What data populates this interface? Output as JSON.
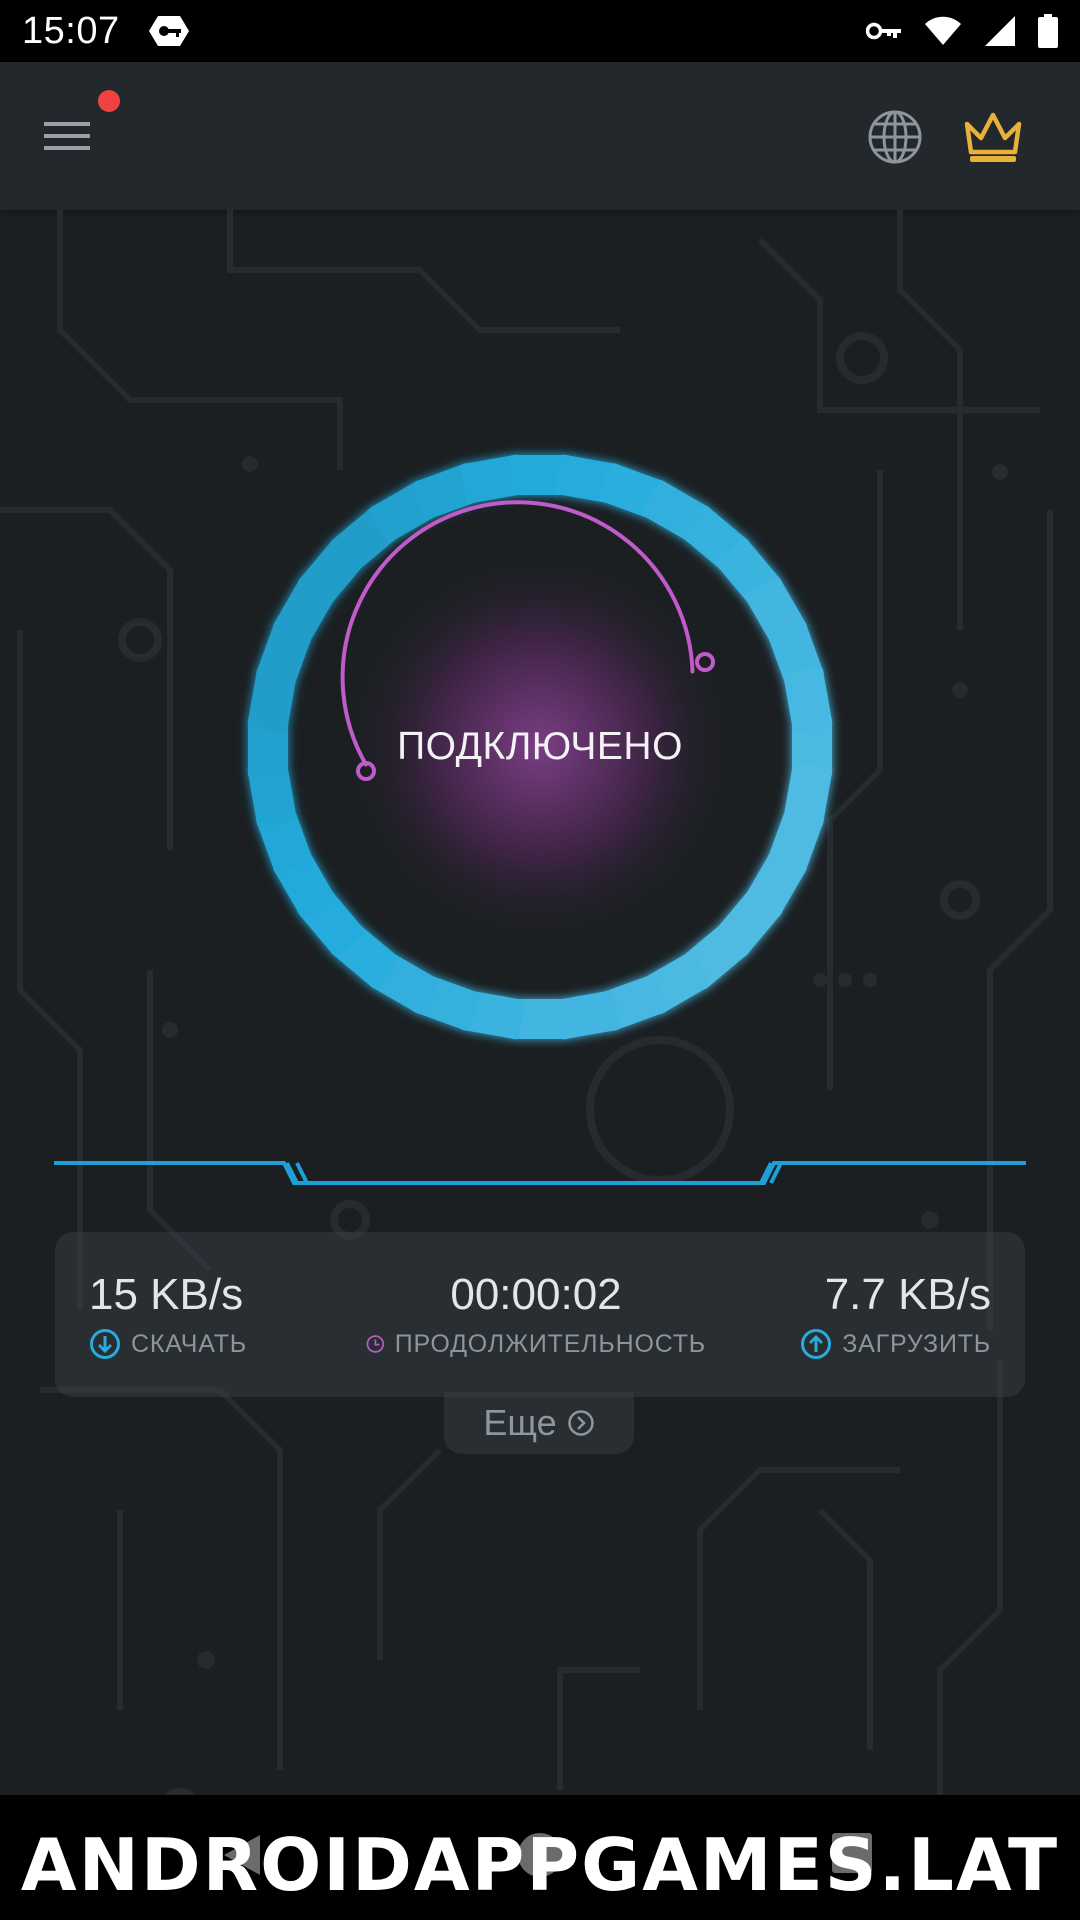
{
  "status_bar": {
    "time": "15:07",
    "icons": [
      "vpn-badge-icon",
      "key-icon",
      "wifi-icon",
      "signal-icon",
      "battery-icon"
    ]
  },
  "app_bar": {
    "icons": [
      "menu-icon",
      "globe-icon",
      "crown-icon"
    ],
    "has_notification": true
  },
  "connection": {
    "status": "ПОДКЛЮЧЕНО",
    "ring_color": "#3db7e4",
    "arc_color": "#c05bc9"
  },
  "stats": {
    "download": {
      "value": "15 KB/s",
      "label": "СКАЧАТЬ"
    },
    "duration": {
      "value": "00:00:02",
      "label": "ПРОДОЛЖИТЕЛЬНОСТЬ"
    },
    "upload": {
      "value": "7.7 KB/s",
      "label": "ЗАГРУЗИТЬ"
    }
  },
  "more": {
    "label": "Еще"
  },
  "watermark": "ANDROIDAPPGAMES.LAT",
  "colors": {
    "accent_blue": "#2aa9dc",
    "accent_purple": "#b55dc5",
    "crown": "#e8b13a",
    "notification": "#f14242"
  }
}
